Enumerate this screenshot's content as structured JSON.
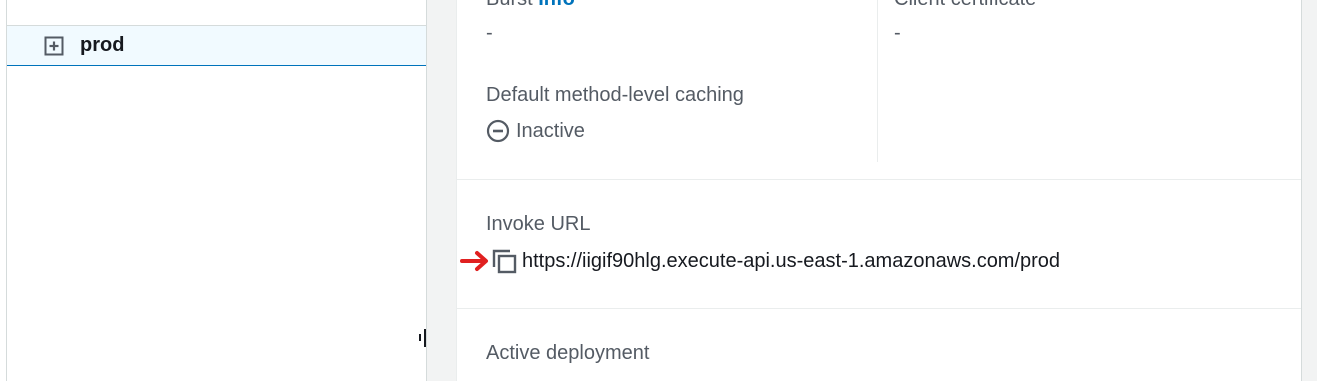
{
  "tree": {
    "node_label": "prod",
    "expand_icon": "plus-square-icon"
  },
  "details": {
    "burst": {
      "label": "Burst",
      "info_link": "Info",
      "value": "-"
    },
    "client_certificate": {
      "label": "Client certificate",
      "value": "-"
    },
    "caching": {
      "label": "Default method-level caching",
      "status": "Inactive",
      "status_icon": "minus-circle-icon"
    },
    "invoke_url": {
      "label": "Invoke URL",
      "value": "https://iigif90hlg.execute-api.us-east-1.amazonaws.com/prod",
      "copy_icon": "copy-icon"
    },
    "active_deployment": {
      "label": "Active deployment"
    }
  },
  "colors": {
    "link": "#0073bb",
    "annotation_arrow": "#e02020",
    "text_secondary": "#545b64",
    "text_primary": "#16191f"
  }
}
